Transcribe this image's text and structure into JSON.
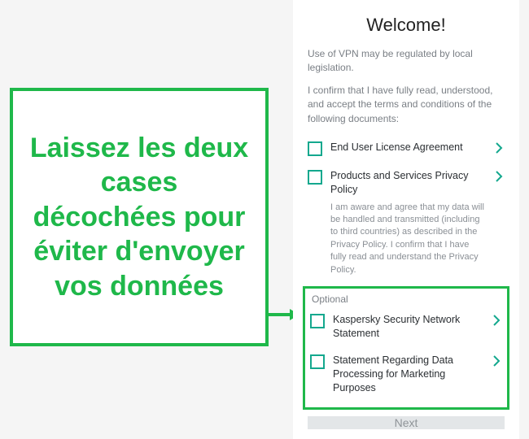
{
  "callout": {
    "text": "Laissez les deux cases décochées pour éviter d'envoyer vos données"
  },
  "colors": {
    "accent_green": "#1fb84a",
    "teal": "#14a88e",
    "muted": "#7a7f85"
  },
  "screen": {
    "title": "Welcome!",
    "intro1": "Use of VPN may be regulated by local legislation.",
    "intro2": "I confirm that I have fully read, understood, and accept the terms and conditions of the following documents:",
    "required": [
      {
        "label": "End User License Agreement",
        "checked": false
      },
      {
        "label": "Products and Services Privacy Policy",
        "checked": false,
        "desc": "I am aware and agree that my data will be handled and transmitted (including to third countries) as described in the Privacy Policy. I confirm that I have fully read and understand the Privacy Policy."
      }
    ],
    "optional_label": "Optional",
    "optional": [
      {
        "label": "Kaspersky Security Network Statement",
        "checked": false
      },
      {
        "label": "Statement Regarding Data Processing for Marketing Purposes",
        "checked": false
      }
    ],
    "next_label": "Next"
  }
}
